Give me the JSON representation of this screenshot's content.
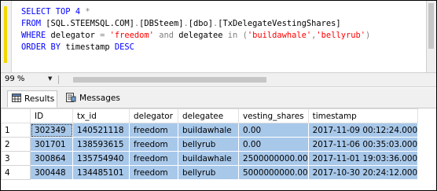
{
  "editor": {
    "lines": [
      [
        {
          "t": "SELECT TOP 4 ",
          "c": "kw"
        },
        {
          "t": "*",
          "c": "op"
        }
      ],
      [
        {
          "t": "FROM ",
          "c": "kw"
        },
        {
          "t": "[SQL.STEEMSQL.COM]",
          "c": ""
        },
        {
          "t": ".",
          "c": "op"
        },
        {
          "t": "[DBSteem]",
          "c": ""
        },
        {
          "t": ".",
          "c": "op"
        },
        {
          "t": "[dbo]",
          "c": ""
        },
        {
          "t": ".",
          "c": "op"
        },
        {
          "t": "[TxDelegateVestingShares]",
          "c": ""
        }
      ],
      [
        {
          "t": "WHERE ",
          "c": "kw"
        },
        {
          "t": "delegator ",
          "c": ""
        },
        {
          "t": "= ",
          "c": "op"
        },
        {
          "t": "'freedom' ",
          "c": "str"
        },
        {
          "t": "and ",
          "c": "op"
        },
        {
          "t": "delegatee ",
          "c": ""
        },
        {
          "t": "in ",
          "c": "op"
        },
        {
          "t": "(",
          "c": "op"
        },
        {
          "t": "'buildawhale'",
          "c": "str"
        },
        {
          "t": ",",
          "c": "op"
        },
        {
          "t": "'bellyrub'",
          "c": "str"
        },
        {
          "t": ")",
          "c": "op"
        }
      ],
      [
        {
          "t": "ORDER BY ",
          "c": "kw"
        },
        {
          "t": "timestamp ",
          "c": ""
        },
        {
          "t": "DESC",
          "c": "kw"
        }
      ]
    ]
  },
  "zoom": {
    "value": "99 %",
    "arrow": "▼"
  },
  "tabs": {
    "results_label": "Results",
    "messages_label": "Messages"
  },
  "grid": {
    "columns": [
      "ID",
      "tx_id",
      "delegator",
      "delegatee",
      "vesting_shares",
      "timestamp"
    ],
    "rows": [
      {
        "num": "1",
        "cells": [
          "302349",
          "140521118",
          "freedom",
          "buildawhale",
          "0.00",
          "2017-11-09 00:12:24.000"
        ]
      },
      {
        "num": "2",
        "cells": [
          "301701",
          "138593615",
          "freedom",
          "bellyrub",
          "0.00",
          "2017-11-06 00:35:03.000"
        ]
      },
      {
        "num": "3",
        "cells": [
          "300864",
          "135754940",
          "freedom",
          "buildawhale",
          "2500000000.00",
          "2017-11-01 19:03:36.000"
        ]
      },
      {
        "num": "4",
        "cells": [
          "300448",
          "134485101",
          "freedom",
          "bellyrub",
          "5000000000.00",
          "2017-10-30 20:24:12.000"
        ]
      }
    ]
  },
  "colors": {
    "keyword": "#0000ff",
    "string": "#ff0000",
    "operator": "#808080",
    "selection": "#a8c8ea",
    "change_marker": "#f2d600"
  },
  "icons": {
    "results_tab": "grid-icon",
    "messages_tab": "messages-icon"
  }
}
